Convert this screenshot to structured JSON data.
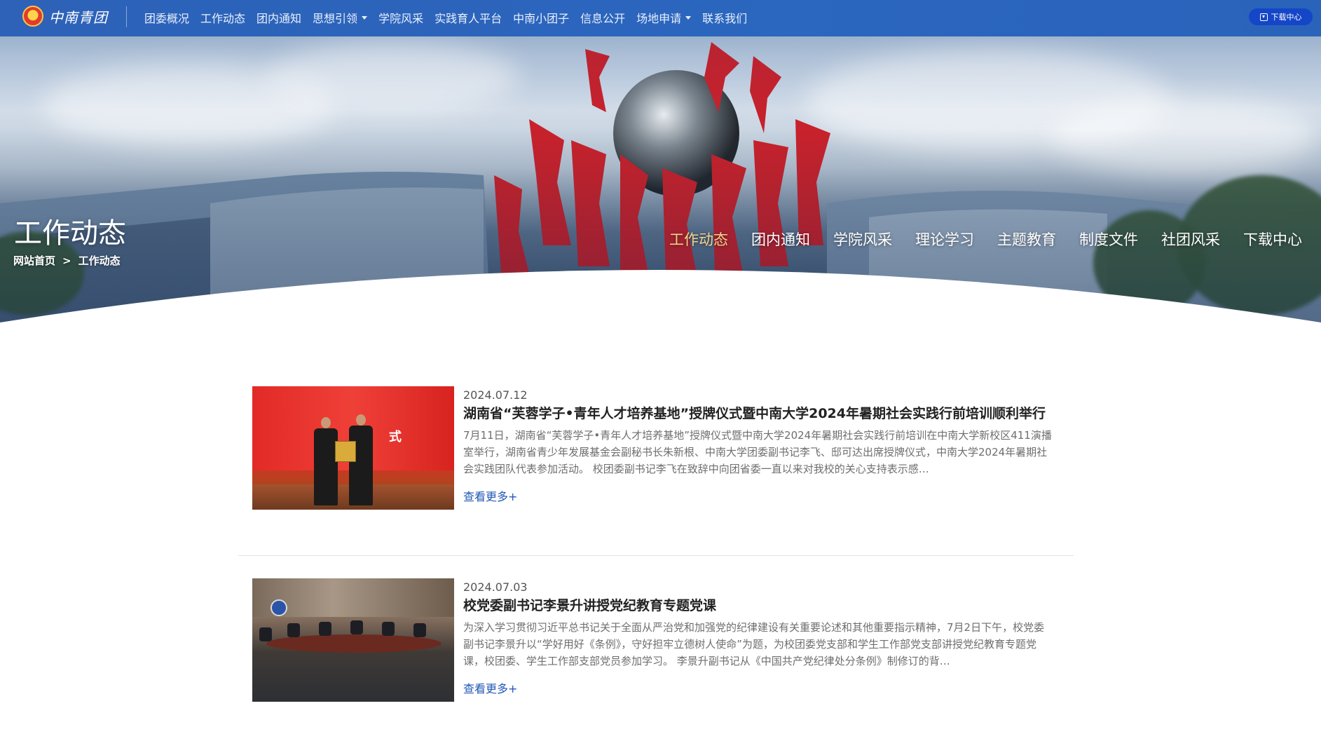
{
  "header": {
    "logo_text": "中南青团",
    "nav": [
      {
        "label": "团委概况",
        "has_dropdown": false
      },
      {
        "label": "工作动态",
        "has_dropdown": false
      },
      {
        "label": "团内通知",
        "has_dropdown": false
      },
      {
        "label": "思想引领",
        "has_dropdown": true
      },
      {
        "label": "学院风采",
        "has_dropdown": false
      },
      {
        "label": "实践育人平台",
        "has_dropdown": false
      },
      {
        "label": "中南小团子",
        "has_dropdown": false
      },
      {
        "label": "信息公开",
        "has_dropdown": false
      },
      {
        "label": "场地申请",
        "has_dropdown": true
      },
      {
        "label": "联系我们",
        "has_dropdown": false
      }
    ],
    "download_label": "下载中心"
  },
  "banner": {
    "title": "工作动态",
    "breadcrumb": {
      "home": "网站首页",
      "separator": ">",
      "current": "工作动态"
    },
    "subnav": [
      {
        "label": "工作动态",
        "active": true
      },
      {
        "label": "团内通知",
        "active": false
      },
      {
        "label": "学院风采",
        "active": false
      },
      {
        "label": "理论学习",
        "active": false
      },
      {
        "label": "主题教育",
        "active": false
      },
      {
        "label": "制度文件",
        "active": false
      },
      {
        "label": "社团风采",
        "active": false
      },
      {
        "label": "下载中心",
        "active": false
      }
    ]
  },
  "articles": [
    {
      "date": "2024.07.12",
      "title": "湖南省“芙蓉学子•青年人才培养基地”授牌仪式暨中南大学2024年暑期社会实践行前培训顺利举行",
      "summary": " 7月11日，湖南省“芙蓉学子•青年人才培养基地”授牌仪式暨中南大学2024年暑期社会实践行前培训在中南大学新校区411演播室举行，湖南省青少年发展基金会副秘书长朱新根、中南大学团委副书记李飞、邸可达出席授牌仪式，中南大学2024年暑期社会实践团队代表参加活动。 校团委副书记李飞在致辞中向团省委一直以来对我校的关心支持表示感…",
      "more_label": "查看更多+",
      "thumb_text": "式"
    },
    {
      "date": "2024.07.03",
      "title": "校党委副书记李景升讲授党纪教育专题党课",
      "summary": "为深入学习贯彻习近平总书记关于全面从严治党和加强党的纪律建设有关重要论述和其他重要指示精神，7月2日下午，校党委副书记李景升以“学好用好《条例》，守好担牢立德树人使命”为题，为校团委党支部和学生工作部党支部讲授党纪教育专题党课，校团委、学生工作部支部党员参加学习。 李景升副书记从《中国共产党纪律处分条例》制修订的背…",
      "more_label": "查看更多+"
    }
  ],
  "colors": {
    "topbar": "#2b64bb",
    "download_button": "#1446c7",
    "active_subnav": "#f3d28a",
    "more_link": "#2157b6"
  }
}
